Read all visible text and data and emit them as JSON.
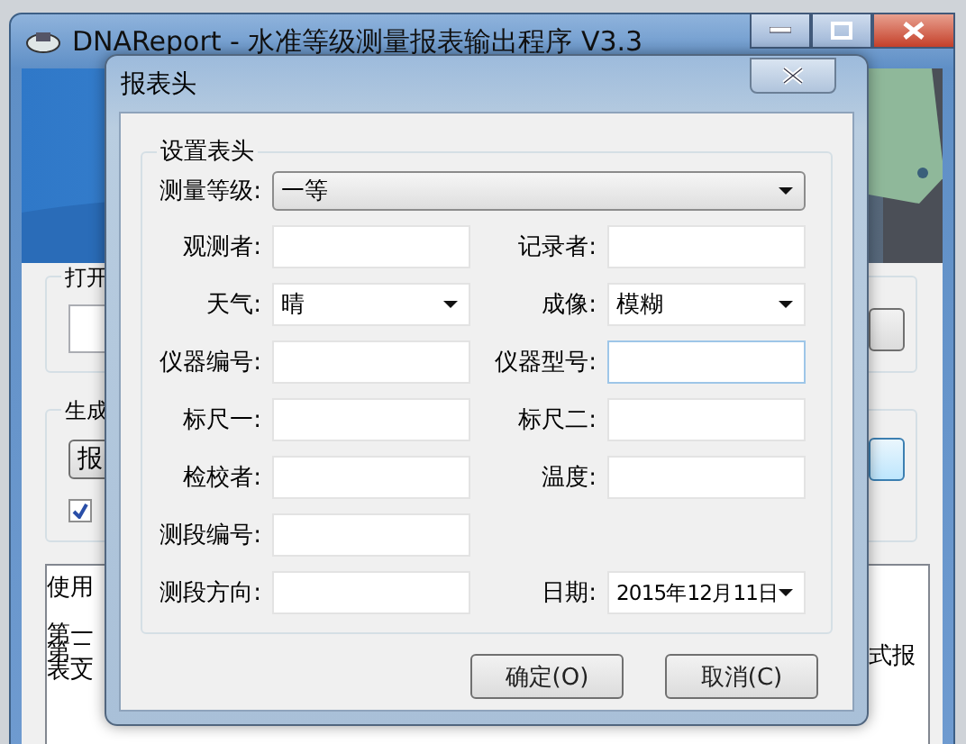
{
  "main_window": {
    "title": "DNAReport - 水准等级测量报表输出程序 V3.3",
    "open_group": {
      "label": "打开"
    },
    "generate_group": {
      "label": "生成",
      "button": "报",
      "checkbox": {
        "checked": true
      }
    },
    "usage": {
      "lines": [
        "使用",
        "第一",
        "第二",
        "表文"
      ],
      "fragment": "式报"
    }
  },
  "dialog": {
    "title": "报表头",
    "group": "设置表头",
    "level": {
      "label": "测量等级:",
      "value": "一等"
    },
    "rows": [
      [
        {
          "label": "观测者:",
          "kind": "text",
          "focused": false
        },
        {
          "label": "记录者:",
          "kind": "text",
          "focused": false
        }
      ],
      [
        {
          "label": "天气:",
          "kind": "combo",
          "value": "晴",
          "focused": false
        },
        {
          "label": "成像:",
          "kind": "combo",
          "value": "模糊",
          "focused": false
        }
      ],
      [
        {
          "label": "仪器编号:",
          "kind": "text",
          "focused": false
        },
        {
          "label": "仪器型号:",
          "kind": "text",
          "focused": true
        }
      ],
      [
        {
          "label": "标尺一:",
          "kind": "text",
          "focused": false
        },
        {
          "label": "标尺二:",
          "kind": "text",
          "focused": false
        }
      ],
      [
        {
          "label": "检校者:",
          "kind": "text",
          "focused": false
        },
        {
          "label": "温度:",
          "kind": "text",
          "focused": false
        }
      ],
      [
        {
          "label": "测段编号:",
          "kind": "text",
          "focused": false
        }
      ],
      [
        {
          "label": "测段方向:",
          "kind": "text",
          "focused": false
        },
        {
          "label": "日期:",
          "kind": "date",
          "value": "2015年12月11日",
          "focused": false
        }
      ]
    ],
    "buttons": [
      "确定(O)",
      "取消(C)"
    ]
  }
}
